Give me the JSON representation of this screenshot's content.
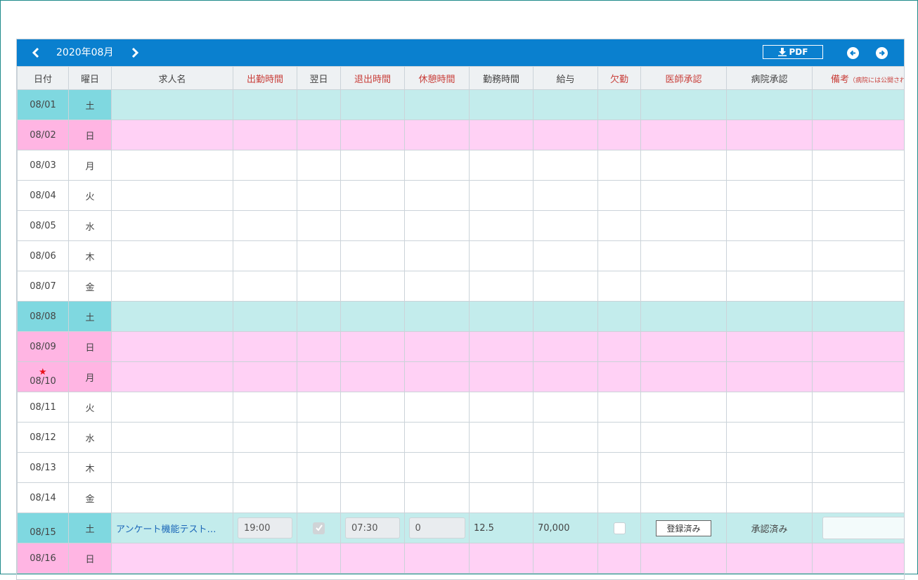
{
  "toolbar": {
    "month": "2020年08月",
    "pdf_label": "PDF"
  },
  "columns": [
    {
      "label": "日付",
      "required": false
    },
    {
      "label": "曜日",
      "required": false
    },
    {
      "label": "求人名",
      "required": false
    },
    {
      "label": "出勤時間",
      "required": true
    },
    {
      "label": "翌日",
      "required": false
    },
    {
      "label": "退出時間",
      "required": true
    },
    {
      "label": "休憩時間",
      "required": true
    },
    {
      "label": "勤務時間",
      "required": false
    },
    {
      "label": "給与",
      "required": false
    },
    {
      "label": "欠勤",
      "required": true
    },
    {
      "label": "医師承認",
      "required": true
    },
    {
      "label": "病院承認",
      "required": false
    },
    {
      "label": "備考",
      "required": true,
      "note": "（病院には公開されま"
    }
  ],
  "rows": [
    {
      "date": "08/01",
      "dow": "土",
      "type": "sat"
    },
    {
      "date": "08/02",
      "dow": "日",
      "type": "sun"
    },
    {
      "date": "08/03",
      "dow": "月",
      "type": "weekday"
    },
    {
      "date": "08/04",
      "dow": "火",
      "type": "weekday"
    },
    {
      "date": "08/05",
      "dow": "水",
      "type": "weekday"
    },
    {
      "date": "08/06",
      "dow": "木",
      "type": "weekday"
    },
    {
      "date": "08/07",
      "dow": "金",
      "type": "weekday"
    },
    {
      "date": "08/08",
      "dow": "土",
      "type": "sat"
    },
    {
      "date": "08/09",
      "dow": "日",
      "type": "sun"
    },
    {
      "date": "08/10",
      "dow": "月",
      "type": "sun",
      "star": true
    },
    {
      "date": "08/11",
      "dow": "火",
      "type": "weekday"
    },
    {
      "date": "08/12",
      "dow": "水",
      "type": "weekday"
    },
    {
      "date": "08/13",
      "dow": "木",
      "type": "weekday"
    },
    {
      "date": "08/14",
      "dow": "金",
      "type": "weekday"
    },
    {
      "date": "08/15",
      "dow": "土",
      "type": "sat",
      "entry": {
        "job": "アンケート機能テスト…",
        "start": "19:00",
        "next_day": true,
        "end": "07:30",
        "rest": "0",
        "hours": "12.5",
        "pay": "70,000",
        "absent": false,
        "doctor": "登録済み",
        "hospital": "承認済み",
        "note": ""
      }
    },
    {
      "date": "08/16",
      "dow": "日",
      "type": "sun"
    }
  ],
  "colors": {
    "toolbar": "#0a80cf",
    "saturday": "#c3ecec",
    "sunday": "#ffd1f5",
    "required_header": "#c9413c"
  },
  "icons": [
    "chevron-left-icon",
    "chevron-right-icon",
    "download-icon",
    "arrow-left-circle-icon",
    "arrow-right-circle-icon",
    "star-icon",
    "checkmark-icon"
  ]
}
